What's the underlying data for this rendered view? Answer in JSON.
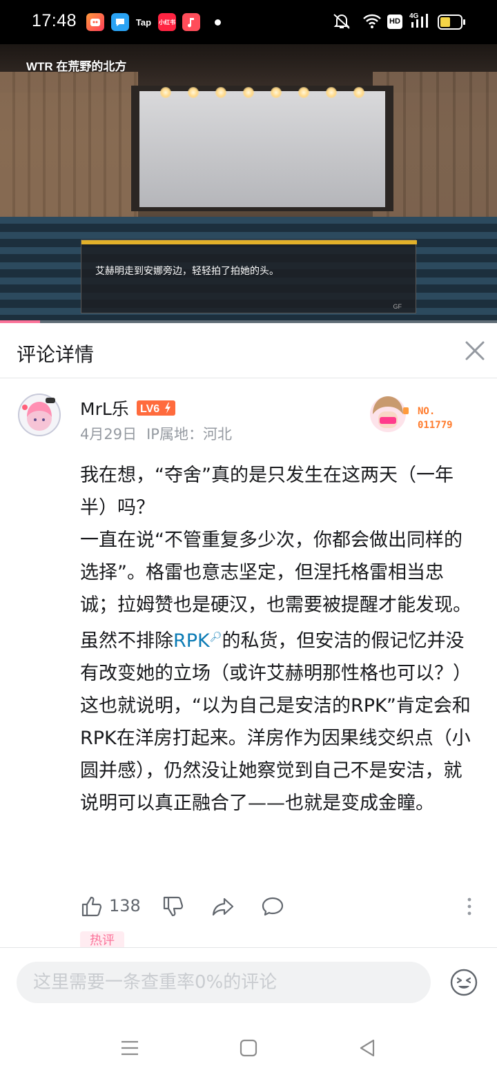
{
  "status_bar": {
    "time": "17:48",
    "apps": [
      "Tap",
      "小红书"
    ],
    "network": "4G",
    "hd": "HD"
  },
  "video": {
    "channel": "WTR 在荒野的北方",
    "subtitle": "艾赫明走到安娜旁边，轻轻拍了拍她的头。",
    "watermark": "GF",
    "progress_fraction": 0.08
  },
  "header": {
    "title": "评论详情"
  },
  "comment": {
    "username": "MrL乐",
    "level": "LV6",
    "date": "4月29日",
    "ip_location": "IP属地：河北",
    "fan_label": "NO.",
    "fan_number": "011779",
    "content_part1": "我在想，“夺舍”真的是只发生在这两天（一年半）吗？\n一直在说“不管重复多少次，你都会做出同样的选择”。格雷也意志坚定，但涅托格雷相当忠诚；拉姆赞也是硬汉，也需要被提醒才能发现。虽然不排除",
    "content_link": "RPK",
    "content_part2": "的私货，但安洁的假记忆并没有改变她的立场（或许艾赫明那性格也可以？）\n这也就说明，“以为自己是安洁的RPK”肯定会和RPK在洋房打起来。洋房作为因果线交织点（小圆并感），仍然没让她察觉到自己不是安洁，就说明可以真正融合了——也就是变成金瞳。",
    "likes": "138",
    "tag": "热评"
  },
  "input": {
    "placeholder": "这里需要一条查重率0%的评论"
  },
  "colors": {
    "accent": "#fb7299",
    "link": "#0b7bb5",
    "fan_number": "#ff7b2c"
  }
}
